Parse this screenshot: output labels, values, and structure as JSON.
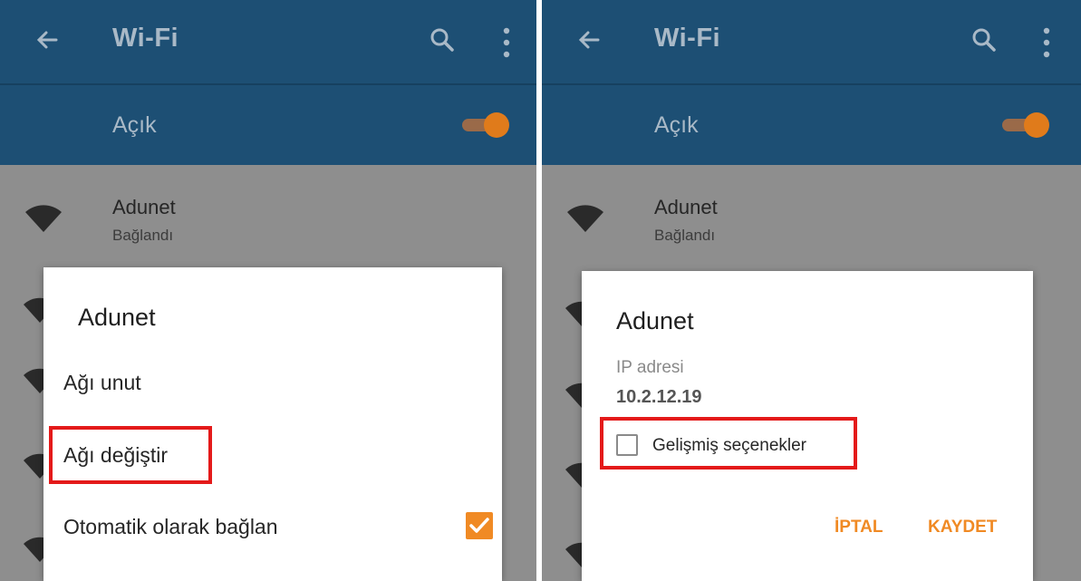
{
  "appbar": {
    "title": "Wi-Fi"
  },
  "switch": {
    "label": "Açık"
  },
  "network": {
    "name": "Adunet",
    "status": "Bağlandı"
  },
  "menu_dialog": {
    "title": "Adunet",
    "forget": "Ağı unut",
    "modify": "Ağı değiştir",
    "auto_connect": "Otomatik olarak bağlan"
  },
  "modify_dialog": {
    "title": "Adunet",
    "ip_label": "IP adresi",
    "ip_value": "10.2.12.19",
    "advanced": "Gelişmiş seçenekler",
    "cancel": "İPTAL",
    "save": "KAYDET"
  },
  "colors": {
    "appbar": "#1d4f74",
    "accent": "#f08a24",
    "highlight": "#e41a1a",
    "scrim": "#8e8e8e"
  }
}
